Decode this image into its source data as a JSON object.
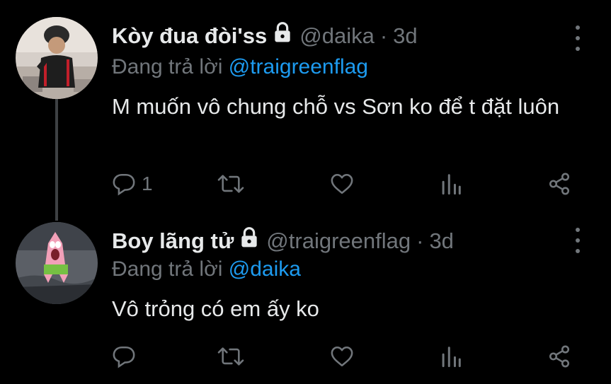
{
  "tweets": [
    {
      "name": "Kòy đua đòi'ss",
      "handle": "@daika",
      "separator": "·",
      "time": "3d",
      "reply_prefix": "Đang trả lời",
      "reply_mention": "@traigreenflag",
      "text": "M muốn vô chung chỗ vs Sơn ko để t đặt luôn",
      "reply_count": "1"
    },
    {
      "name": "Boy lãng tử",
      "handle": "@traigreenflag",
      "separator": "·",
      "time": "3d",
      "reply_prefix": "Đang trả lời",
      "reply_mention": "@daika",
      "text": "Vô trỏng có em ấy ko",
      "reply_count": ""
    }
  ],
  "icons": {
    "lock": "lock-icon",
    "more": "more-vertical-icon",
    "reply": "reply-icon",
    "retweet": "retweet-icon",
    "like": "heart-icon",
    "analytics": "analytics-icon",
    "share": "share-icon"
  },
  "colors": {
    "background": "#000000",
    "text": "#e7e9ea",
    "muted": "#71767b",
    "link": "#1d9bf0",
    "thread_line": "#3e4144"
  }
}
